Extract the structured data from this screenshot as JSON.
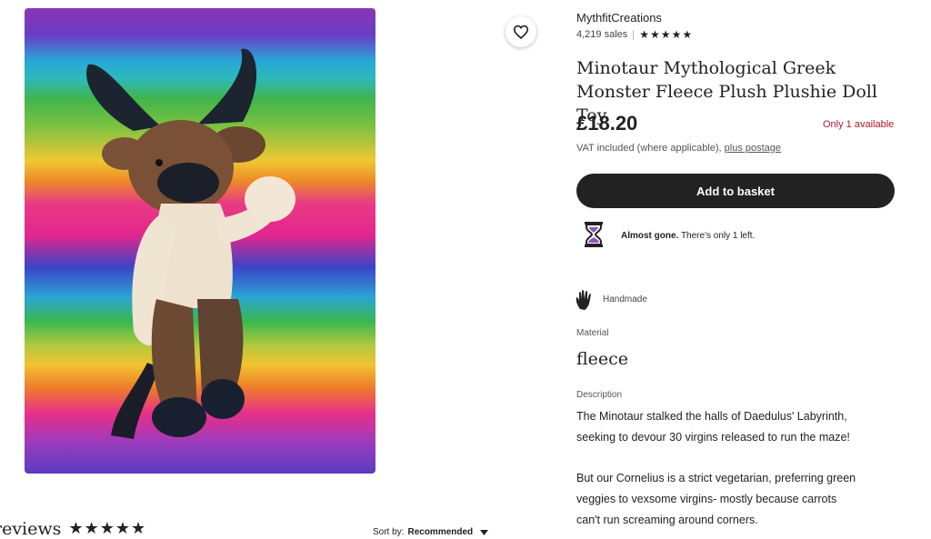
{
  "shop": {
    "name": "MythfitCreations",
    "sales": "4,219 sales",
    "rating_stars": 5
  },
  "product": {
    "title": "Minotaur Mythological Greek Monster Fleece Plush Plushie Doll Toy",
    "price": "£18.20",
    "availability": "Only 1 available",
    "vat_text": "VAT included (where applicable),",
    "postage_link": "plus postage",
    "add_to_basket": "Add to basket",
    "scarcity_bold": "Almost gone.",
    "scarcity_rest": " There's only 1 left.",
    "handmade": "Handmade",
    "material_label": "Material",
    "material_value": "fleece",
    "description_label": "Description",
    "description_lines": [
      "The Minotaur stalked the halls of Daedulus' Labyrinth,",
      "seeking to devour 30 virgins released to run the maze!",
      "",
      "But our Cornelius is a strict vegetarian, preferring green",
      "veggies to vexsome virgins- mostly because carrots",
      "can't run screaming around corners."
    ]
  },
  "reviews": {
    "heading": "reviews",
    "stars": 5,
    "sort_label": "Sort by:",
    "sort_value": "Recommended"
  },
  "colors": {
    "accent_button": "#222222",
    "availability_red": "#a61a2e"
  },
  "icons": {
    "favorite": "heart-icon",
    "hourglass": "hourglass-icon",
    "handmade": "hand-icon",
    "sort": "caret-down-icon",
    "rating": "star-icon"
  }
}
